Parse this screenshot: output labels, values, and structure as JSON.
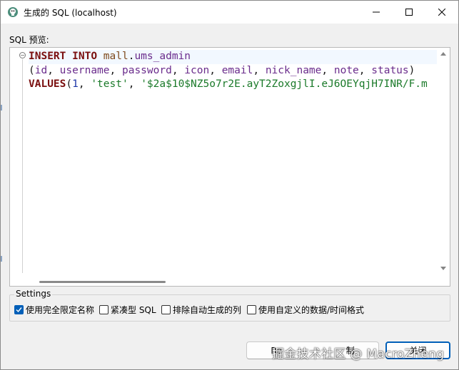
{
  "window": {
    "title": "生成的 SQL (localhost)",
    "controls": {
      "minimize": "minimize-icon",
      "maximize": "maximize-icon",
      "close": "close-icon"
    }
  },
  "editor": {
    "label": "SQL 预览:",
    "lines": [
      [
        {
          "t": "INSERT",
          "c": "kw"
        },
        {
          "t": " ",
          "c": "punct"
        },
        {
          "t": "INTO",
          "c": "kw"
        },
        {
          "t": " ",
          "c": "punct"
        },
        {
          "t": "mall",
          "c": "tbl"
        },
        {
          "t": ".",
          "c": "punct"
        },
        {
          "t": "ums_admin",
          "c": "col"
        }
      ],
      [
        {
          "t": "(",
          "c": "punct"
        },
        {
          "t": "id",
          "c": "col"
        },
        {
          "t": ", ",
          "c": "punct"
        },
        {
          "t": "username",
          "c": "col"
        },
        {
          "t": ", ",
          "c": "punct"
        },
        {
          "t": "password",
          "c": "col"
        },
        {
          "t": ", ",
          "c": "punct"
        },
        {
          "t": "icon",
          "c": "col"
        },
        {
          "t": ", ",
          "c": "punct"
        },
        {
          "t": "email",
          "c": "col"
        },
        {
          "t": ", ",
          "c": "punct"
        },
        {
          "t": "nick_name",
          "c": "col"
        },
        {
          "t": ", ",
          "c": "punct"
        },
        {
          "t": "note",
          "c": "col"
        },
        {
          "t": ", ",
          "c": "punct"
        },
        {
          "t": "status",
          "c": "col"
        },
        {
          "t": ")",
          "c": "punct"
        }
      ],
      [
        {
          "t": "VALUES",
          "c": "kw"
        },
        {
          "t": "(",
          "c": "punct"
        },
        {
          "t": "1",
          "c": "num"
        },
        {
          "t": ", ",
          "c": "punct"
        },
        {
          "t": "'test'",
          "c": "str"
        },
        {
          "t": ", ",
          "c": "punct"
        },
        {
          "t": "'$2a$10$NZ5o7r2E.ayT2ZoxgjlI.eJ6OEYqjH7INR/F.m",
          "c": "str"
        }
      ]
    ]
  },
  "settings": {
    "title": "Settings",
    "options": [
      {
        "label": "使用完全限定名称",
        "checked": true
      },
      {
        "label": "紧凑型 SQL",
        "checked": false
      },
      {
        "label": "排除自动生成的列",
        "checked": false
      },
      {
        "label": "使用自定义的数据/时间格式",
        "checked": false
      }
    ]
  },
  "buttons": {
    "copy": "Re",
    "copy_tail": "制",
    "close": "关闭"
  },
  "watermark": "掘金技术社区 @ MacroZheng",
  "colors": {
    "accent": "#005fb8",
    "keyword": "#7a0f0f",
    "string": "#1b7a2a",
    "number": "#1f38a8",
    "identifier": "#6a2c8c"
  }
}
